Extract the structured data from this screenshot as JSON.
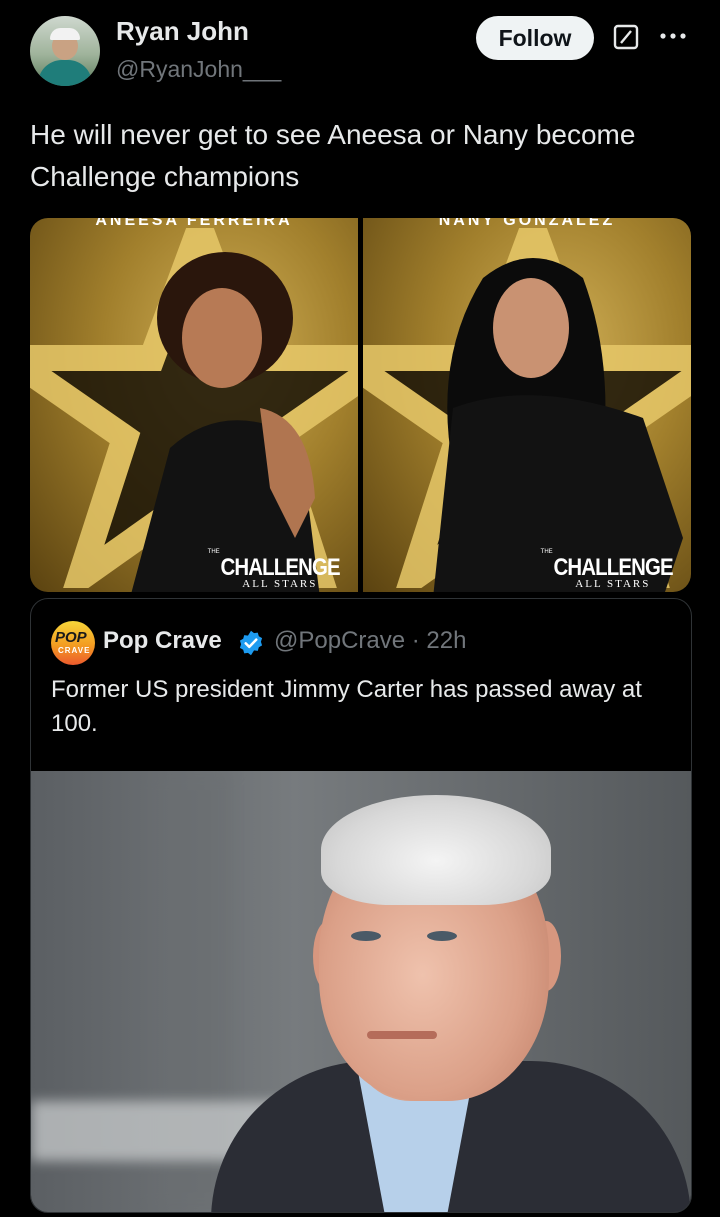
{
  "author": {
    "name": "Ryan John",
    "handle": "@RyanJohn___",
    "follow_label": "Follow"
  },
  "tweet": {
    "text": "He will never get to see Aneesa or Nany become Challenge champions"
  },
  "media": {
    "left": {
      "caption": "ANEESA FERREIRA",
      "logo_top": "THE",
      "logo_main": "CHALLENGE",
      "logo_sub": "ALL STARS"
    },
    "right": {
      "caption": "NANY GONZALEZ",
      "logo_top": "THE",
      "logo_main": "CHALLENGE",
      "logo_sub": "ALL STARS"
    }
  },
  "quoted": {
    "avatar_text_top": "POP",
    "avatar_text_bottom": "CRAVE",
    "name": "Pop Crave",
    "meta": "@PopCrave · 22h",
    "text": "Former US president Jimmy Carter has passed away at 100."
  },
  "colors": {
    "background": "#000000",
    "text": "#e7e9ea",
    "muted": "#71767b",
    "verified": "#1d9bf0"
  },
  "icons": [
    "grok-icon",
    "more-icon",
    "verified-badge-icon"
  ]
}
